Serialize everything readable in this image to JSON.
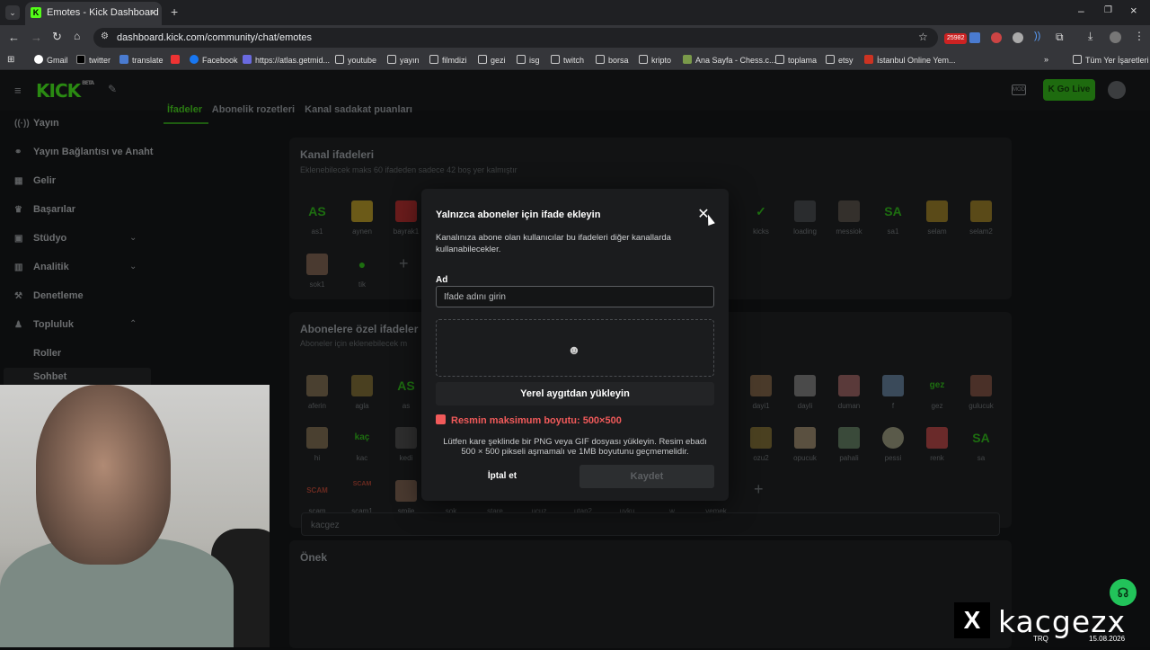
{
  "browser": {
    "tab_title": "Emotes - Kick Dashboard",
    "url": "dashboard.kick.com/community/chat/emotes",
    "bookmarks": [
      "Gmail",
      "twitter",
      "translate",
      "Facebook",
      "https://atlas.getmid...",
      "youtube",
      "yayın",
      "filmdizi",
      "gezi",
      "isg",
      "twitch",
      "borsa",
      "kripto",
      "Ana Sayfa - Chess.c...",
      "toplama",
      "etsy",
      "İstanbul Online Yem...",
      "Tüm Yer İşaretleri"
    ],
    "ext_badge": "25982"
  },
  "header": {
    "logo": "KICK",
    "logo_tag": "BETA",
    "go_live": "Go Live"
  },
  "sidebar": {
    "items": [
      {
        "label": "Yayın",
        "icon": "broadcast-icon"
      },
      {
        "label": "Yayın Bağlantısı ve Anahtarı",
        "icon": "link-icon"
      },
      {
        "label": "Gelir",
        "icon": "revenue-icon"
      },
      {
        "label": "Başarılar",
        "icon": "trophy-icon"
      },
      {
        "label": "Stüdyo",
        "icon": "studio-icon"
      },
      {
        "label": "Analitik",
        "icon": "analytics-icon"
      },
      {
        "label": "Denetleme",
        "icon": "gavel-icon"
      },
      {
        "label": "Topluluk",
        "icon": "community-icon"
      },
      {
        "label": "Roller",
        "icon": ""
      },
      {
        "label": "Sohbet",
        "icon": ""
      }
    ]
  },
  "page_tabs": [
    "İfadeler",
    "Abonelik rozetleri",
    "Kanal sadakat puanları"
  ],
  "channel_emotes": {
    "title": "Kanal ifadeleri",
    "subtitle": "Eklenebilecek maks 60 ifadeden sadece 42 boş yer kalmıştır",
    "row1": [
      "as1",
      "aynen",
      "bayrak1",
      "kicks",
      "loading",
      "messiok",
      "sa1",
      "selam",
      "selam2"
    ],
    "row2": [
      "sok1",
      "tik"
    ]
  },
  "sub_emotes": {
    "title": "Abonelere özel ifadeler",
    "subtitle": "Aboneler için eklenebilecek m",
    "row1": [
      "aferin",
      "agla",
      "as",
      "dayi1",
      "dayli",
      "duman",
      "f",
      "gez",
      "gulucuk"
    ],
    "row2": [
      "hi",
      "kac",
      "kedi",
      "ozu2",
      "opucuk",
      "pahali",
      "pessi",
      "renk",
      "sa"
    ],
    "row3": [
      "scam",
      "scam1",
      "smile",
      "sok",
      "stare",
      "ucuz",
      "utan2",
      "uyku",
      "w",
      "yemek"
    ]
  },
  "prefix": {
    "title": "Önek",
    "value": "kacgez"
  },
  "modal": {
    "title": "Yalnızca aboneler için ifade ekleyin",
    "description": "Kanalınıza abone olan kullanıcılar bu ifadeleri diğer kanallarda kullanabilecekler.",
    "name_label": "Ad",
    "name_placeholder": "İfade adını girin",
    "upload_button": "Yerel aygıtdan yükleyin",
    "size_warning": "Resmin maksimum boyutu: 500×500",
    "help_text": "Lütfen kare şeklinde bir PNG veya GIF dosyası yükleyin. Resim ebadı 500 × 500 pikseli aşmamalı ve 1MB boyutunu geçmemelidir.",
    "cancel": "İptal et",
    "save": "Kaydet"
  },
  "watermark": {
    "x": "X",
    "handle": "kacgezx"
  },
  "taskbar": {
    "lang": "TRQ",
    "date": "15.08.2026"
  }
}
